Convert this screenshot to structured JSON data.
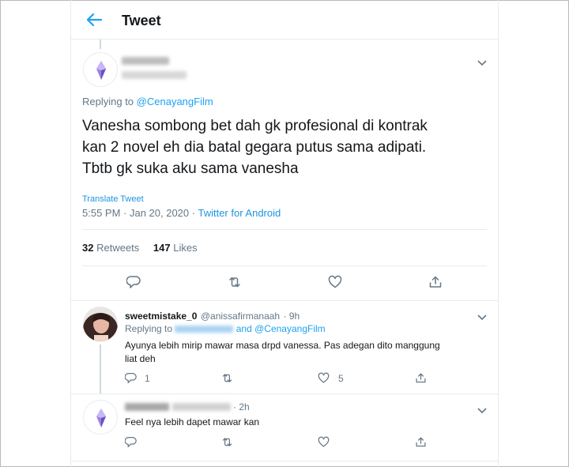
{
  "header": {
    "title": "Tweet"
  },
  "main_tweet": {
    "author_name": "xxxxxxx",
    "author_handle": "xxxxxxxxxxxx",
    "replying_prefix": "Replying to",
    "replying_to": "@CenayangFilm",
    "text_line1": "Vanesha sombong bet dah gk profesional di kontrak",
    "text_line2": "kan 2 novel eh dia batal gegara putus sama adipati.",
    "text_line3": "Tbtb gk suka aku sama vanesha",
    "translate": "Translate Tweet",
    "timestamp": "5:55 PM · Jan 20, 2020 · ",
    "source": "Twitter for Android",
    "retweets_count": "32",
    "retweets_label": "Retweets",
    "likes_count": "147",
    "likes_label": "Likes"
  },
  "replies": [
    {
      "name": "sweetmistake_0",
      "handle": "@anissafirmanaah",
      "time": "· 9h",
      "replying_prefix": "Replying to",
      "replying_and": "and",
      "replying_to": "@CenayangFilm",
      "text_line1": "Ayunya lebih mirip mawar masa drpd vanessa. Pas adegan dito manggung",
      "text_line2": "liat deh",
      "reply_count": "1",
      "like_count": "5"
    },
    {
      "time": "· 2h",
      "text_line1": "Feel nya lebih dapet mawar kan"
    }
  ],
  "colors": {
    "accent": "#1da1f2",
    "secondary": "#657786",
    "border": "#e6ecf0"
  }
}
